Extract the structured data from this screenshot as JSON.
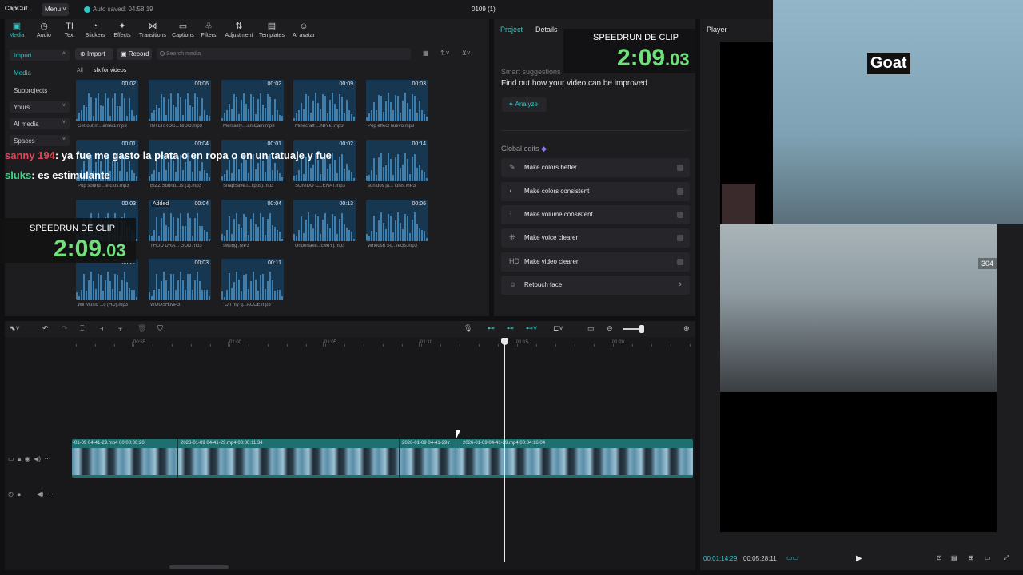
{
  "app": {
    "logo": "CapCut",
    "menu": "Menu",
    "autosave": "Auto saved: 04:58:19",
    "project_title": "0109 (1)"
  },
  "toolbar": [
    {
      "label": "Media",
      "icon": "▣"
    },
    {
      "label": "Audio",
      "icon": "◷"
    },
    {
      "label": "Text",
      "icon": "TI"
    },
    {
      "label": "Stickers",
      "icon": "◔"
    },
    {
      "label": "Effects",
      "icon": "✦"
    },
    {
      "label": "Transitions",
      "icon": "⋈"
    },
    {
      "label": "Captions",
      "icon": "▭"
    },
    {
      "label": "Filters",
      "icon": "♧"
    },
    {
      "label": "Adjustment",
      "icon": "⇅"
    },
    {
      "label": "Templates",
      "icon": "▤"
    },
    {
      "label": "AI avatar",
      "icon": "☺"
    }
  ],
  "sidebar": [
    {
      "label": "Import",
      "caret": "˄"
    },
    {
      "label": "Media",
      "caret": ""
    },
    {
      "label": "Subprojects",
      "caret": ""
    },
    {
      "label": "Yours",
      "caret": "˅"
    },
    {
      "label": "AI media",
      "caret": "˅"
    },
    {
      "label": "Spaces",
      "caret": "˅"
    }
  ],
  "media": {
    "import_label": "Import",
    "record_label": "Record",
    "search_placeholder": "Search media",
    "crumb_all": "All",
    "crumb_folder": "sfx for videos"
  },
  "tiles": [
    {
      "name": "Get out m...amer1.mp3",
      "dur": "00:02",
      "added": ""
    },
    {
      "name": "INTERROG...NIDO.mp3",
      "dur": "00:06",
      "added": ""
    },
    {
      "name": "Mentality....amCam.mp3",
      "dur": "00:02",
      "added": ""
    },
    {
      "name": "Minecraft ...hBYk].mp3",
      "dur": "00:09",
      "added": ""
    },
    {
      "name": "Pop effect nuevo.mp3",
      "dur": "00:03",
      "added": ""
    },
    {
      "name": "Pop sound ...efctos.mp3",
      "dur": "00:01",
      "added": ""
    },
    {
      "name": "BIZZ Sound...ts (1).mp3",
      "dur": "00:04",
      "added": ""
    },
    {
      "name": "SnapSave.i...lipps).mp3",
      "dur": "00:01",
      "added": ""
    },
    {
      "name": "SONIDO C...ENAT.mp3",
      "dur": "00:02",
      "added": ""
    },
    {
      "name": "sonidos ja... ioles.MP3",
      "dur": "00:14",
      "added": ""
    },
    {
      "name": "",
      "dur": "00:03",
      "added": ""
    },
    {
      "name": "THUD DRA... GOD.mp3",
      "dur": "00:04",
      "added": "Added"
    },
    {
      "name": "swung .MP3",
      "dur": "00:04",
      "added": ""
    },
    {
      "name": "Undertake...cwuY].mp3",
      "dur": "00:13",
      "added": ""
    },
    {
      "name": "Whoosh So...fects.mp3",
      "dur": "00:06",
      "added": ""
    },
    {
      "name": "Wii Music ...c (HD).mp3",
      "dur": "00:27",
      "added": ""
    },
    {
      "name": "WOOSH.MP3",
      "dur": "00:03",
      "added": ""
    },
    {
      "name": "\"Oh my g...AUCE.mp3",
      "dur": "00:11",
      "added": ""
    }
  ],
  "chat": [
    {
      "user": "sanny 194",
      "text": ": ya fue me gasto la plata o en ropa o en un tatuaje y fue"
    },
    {
      "user": "sluks",
      "text": ": es estimulante"
    }
  ],
  "speedrun_left": {
    "title": "SPEEDRUN DE CLIP",
    "time": "2:09",
    "ms": ".03"
  },
  "speedrun_right": {
    "title": "SPEEDRUN DE CLIP",
    "time": "2:09",
    "ms": ".03"
  },
  "right_panel": {
    "tab_project": "Project",
    "tab_details": "Details",
    "smart_title": "Smart suggestions",
    "smart_text": "Find out how your video can be improved",
    "analyze": "Analyze",
    "global_title": "Global edits",
    "edits": [
      {
        "label": "Make colors better",
        "icon": "✎"
      },
      {
        "label": "Make colors consistent",
        "icon": "◐"
      },
      {
        "label": "Make volume consistent",
        "icon": "⫶"
      },
      {
        "label": "Make voice clearer",
        "icon": "⁜"
      },
      {
        "label": "Make video clearer",
        "icon": "HD"
      },
      {
        "label": "Retouch face",
        "icon": "☺",
        "chevron": "›"
      }
    ]
  },
  "player": {
    "label": "Player",
    "time_current": "00:01:14:29",
    "time_total": "00:05:28:11",
    "webcam_top_cap": "Goat",
    "webcam_overlay_num": "304"
  },
  "timeline": {
    "ruler": [
      "00:55",
      "01:00",
      "01:05",
      "01:10",
      "01:15",
      "01:20"
    ],
    "clips": [
      {
        "label": "-01-09 04-41-29.mp4  00:00:06:20"
      },
      {
        "label": "2026-01-09 04-41-29.mp4  00:00:11:34"
      },
      {
        "label": "2026-01-09 04-41-29.r"
      },
      {
        "label": "2026-01-09 04-41-29.mp4  00:04:16:04"
      }
    ]
  },
  "colors": {
    "accent": "#2fc6c2",
    "timer": "#6fe07a",
    "clip": "#1e6f70",
    "tile": "#173650"
  }
}
